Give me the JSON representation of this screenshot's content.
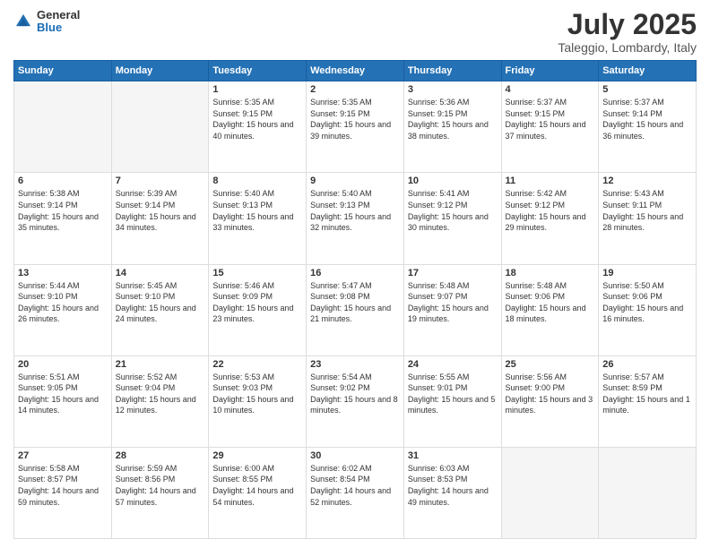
{
  "logo": {
    "general": "General",
    "blue": "Blue"
  },
  "header": {
    "month": "July 2025",
    "location": "Taleggio, Lombardy, Italy"
  },
  "weekdays": [
    "Sunday",
    "Monday",
    "Tuesday",
    "Wednesday",
    "Thursday",
    "Friday",
    "Saturday"
  ],
  "weeks": [
    [
      {
        "day": "",
        "empty": true
      },
      {
        "day": "",
        "empty": true
      },
      {
        "day": "1",
        "sunrise": "5:35 AM",
        "sunset": "9:15 PM",
        "daylight": "15 hours and 40 minutes."
      },
      {
        "day": "2",
        "sunrise": "5:35 AM",
        "sunset": "9:15 PM",
        "daylight": "15 hours and 39 minutes."
      },
      {
        "day": "3",
        "sunrise": "5:36 AM",
        "sunset": "9:15 PM",
        "daylight": "15 hours and 38 minutes."
      },
      {
        "day": "4",
        "sunrise": "5:37 AM",
        "sunset": "9:15 PM",
        "daylight": "15 hours and 37 minutes."
      },
      {
        "day": "5",
        "sunrise": "5:37 AM",
        "sunset": "9:14 PM",
        "daylight": "15 hours and 36 minutes."
      }
    ],
    [
      {
        "day": "6",
        "sunrise": "5:38 AM",
        "sunset": "9:14 PM",
        "daylight": "15 hours and 35 minutes."
      },
      {
        "day": "7",
        "sunrise": "5:39 AM",
        "sunset": "9:14 PM",
        "daylight": "15 hours and 34 minutes."
      },
      {
        "day": "8",
        "sunrise": "5:40 AM",
        "sunset": "9:13 PM",
        "daylight": "15 hours and 33 minutes."
      },
      {
        "day": "9",
        "sunrise": "5:40 AM",
        "sunset": "9:13 PM",
        "daylight": "15 hours and 32 minutes."
      },
      {
        "day": "10",
        "sunrise": "5:41 AM",
        "sunset": "9:12 PM",
        "daylight": "15 hours and 30 minutes."
      },
      {
        "day": "11",
        "sunrise": "5:42 AM",
        "sunset": "9:12 PM",
        "daylight": "15 hours and 29 minutes."
      },
      {
        "day": "12",
        "sunrise": "5:43 AM",
        "sunset": "9:11 PM",
        "daylight": "15 hours and 28 minutes."
      }
    ],
    [
      {
        "day": "13",
        "sunrise": "5:44 AM",
        "sunset": "9:10 PM",
        "daylight": "15 hours and 26 minutes."
      },
      {
        "day": "14",
        "sunrise": "5:45 AM",
        "sunset": "9:10 PM",
        "daylight": "15 hours and 24 minutes."
      },
      {
        "day": "15",
        "sunrise": "5:46 AM",
        "sunset": "9:09 PM",
        "daylight": "15 hours and 23 minutes."
      },
      {
        "day": "16",
        "sunrise": "5:47 AM",
        "sunset": "9:08 PM",
        "daylight": "15 hours and 21 minutes."
      },
      {
        "day": "17",
        "sunrise": "5:48 AM",
        "sunset": "9:07 PM",
        "daylight": "15 hours and 19 minutes."
      },
      {
        "day": "18",
        "sunrise": "5:48 AM",
        "sunset": "9:06 PM",
        "daylight": "15 hours and 18 minutes."
      },
      {
        "day": "19",
        "sunrise": "5:50 AM",
        "sunset": "9:06 PM",
        "daylight": "15 hours and 16 minutes."
      }
    ],
    [
      {
        "day": "20",
        "sunrise": "5:51 AM",
        "sunset": "9:05 PM",
        "daylight": "15 hours and 14 minutes."
      },
      {
        "day": "21",
        "sunrise": "5:52 AM",
        "sunset": "9:04 PM",
        "daylight": "15 hours and 12 minutes."
      },
      {
        "day": "22",
        "sunrise": "5:53 AM",
        "sunset": "9:03 PM",
        "daylight": "15 hours and 10 minutes."
      },
      {
        "day": "23",
        "sunrise": "5:54 AM",
        "sunset": "9:02 PM",
        "daylight": "15 hours and 8 minutes."
      },
      {
        "day": "24",
        "sunrise": "5:55 AM",
        "sunset": "9:01 PM",
        "daylight": "15 hours and 5 minutes."
      },
      {
        "day": "25",
        "sunrise": "5:56 AM",
        "sunset": "9:00 PM",
        "daylight": "15 hours and 3 minutes."
      },
      {
        "day": "26",
        "sunrise": "5:57 AM",
        "sunset": "8:59 PM",
        "daylight": "15 hours and 1 minute."
      }
    ],
    [
      {
        "day": "27",
        "sunrise": "5:58 AM",
        "sunset": "8:57 PM",
        "daylight": "14 hours and 59 minutes."
      },
      {
        "day": "28",
        "sunrise": "5:59 AM",
        "sunset": "8:56 PM",
        "daylight": "14 hours and 57 minutes."
      },
      {
        "day": "29",
        "sunrise": "6:00 AM",
        "sunset": "8:55 PM",
        "daylight": "14 hours and 54 minutes."
      },
      {
        "day": "30",
        "sunrise": "6:02 AM",
        "sunset": "8:54 PM",
        "daylight": "14 hours and 52 minutes."
      },
      {
        "day": "31",
        "sunrise": "6:03 AM",
        "sunset": "8:53 PM",
        "daylight": "14 hours and 49 minutes."
      },
      {
        "day": "",
        "empty": true
      },
      {
        "day": "",
        "empty": true
      }
    ]
  ],
  "labels": {
    "sunrise": "Sunrise:",
    "sunset": "Sunset:",
    "daylight": "Daylight:"
  }
}
